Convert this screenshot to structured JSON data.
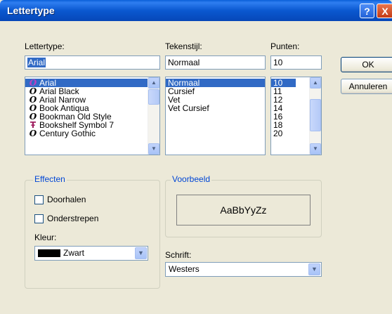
{
  "window": {
    "title": "Lettertype",
    "help_label": "?",
    "close_label": "X"
  },
  "font": {
    "label": "Lettertype:",
    "value": "Arial",
    "items": [
      {
        "name": "Arial",
        "icon": "opentype-icon"
      },
      {
        "name": "Arial Black",
        "icon": "opentype-icon"
      },
      {
        "name": "Arial Narrow",
        "icon": "opentype-icon"
      },
      {
        "name": "Book Antiqua",
        "icon": "opentype-icon"
      },
      {
        "name": "Bookman Old Style",
        "icon": "opentype-icon"
      },
      {
        "name": "Bookshelf Symbol 7",
        "icon": "truetype-icon"
      },
      {
        "name": "Century Gothic",
        "icon": "opentype-icon"
      }
    ],
    "selected_index": 0
  },
  "style": {
    "label": "Tekenstijl:",
    "value": "Normaal",
    "items": [
      "Normaal",
      "Cursief",
      "Vet",
      "Vet Cursief"
    ],
    "selected_index": 0
  },
  "size": {
    "label": "Punten:",
    "value": "10",
    "items": [
      "10",
      "11",
      "12",
      "14",
      "16",
      "18",
      "20"
    ],
    "selected_index": 0
  },
  "buttons": {
    "ok": "OK",
    "cancel": "Annuleren"
  },
  "effects": {
    "title": "Effecten",
    "strikeout": "Doorhalen",
    "underline": "Onderstrepen",
    "color_label": "Kleur:",
    "color_value": "Zwart",
    "color_hex": "#000000"
  },
  "preview": {
    "title": "Voorbeeld",
    "sample": "AaBbYyZz"
  },
  "script": {
    "label": "Schrift:",
    "value": "Westers"
  }
}
